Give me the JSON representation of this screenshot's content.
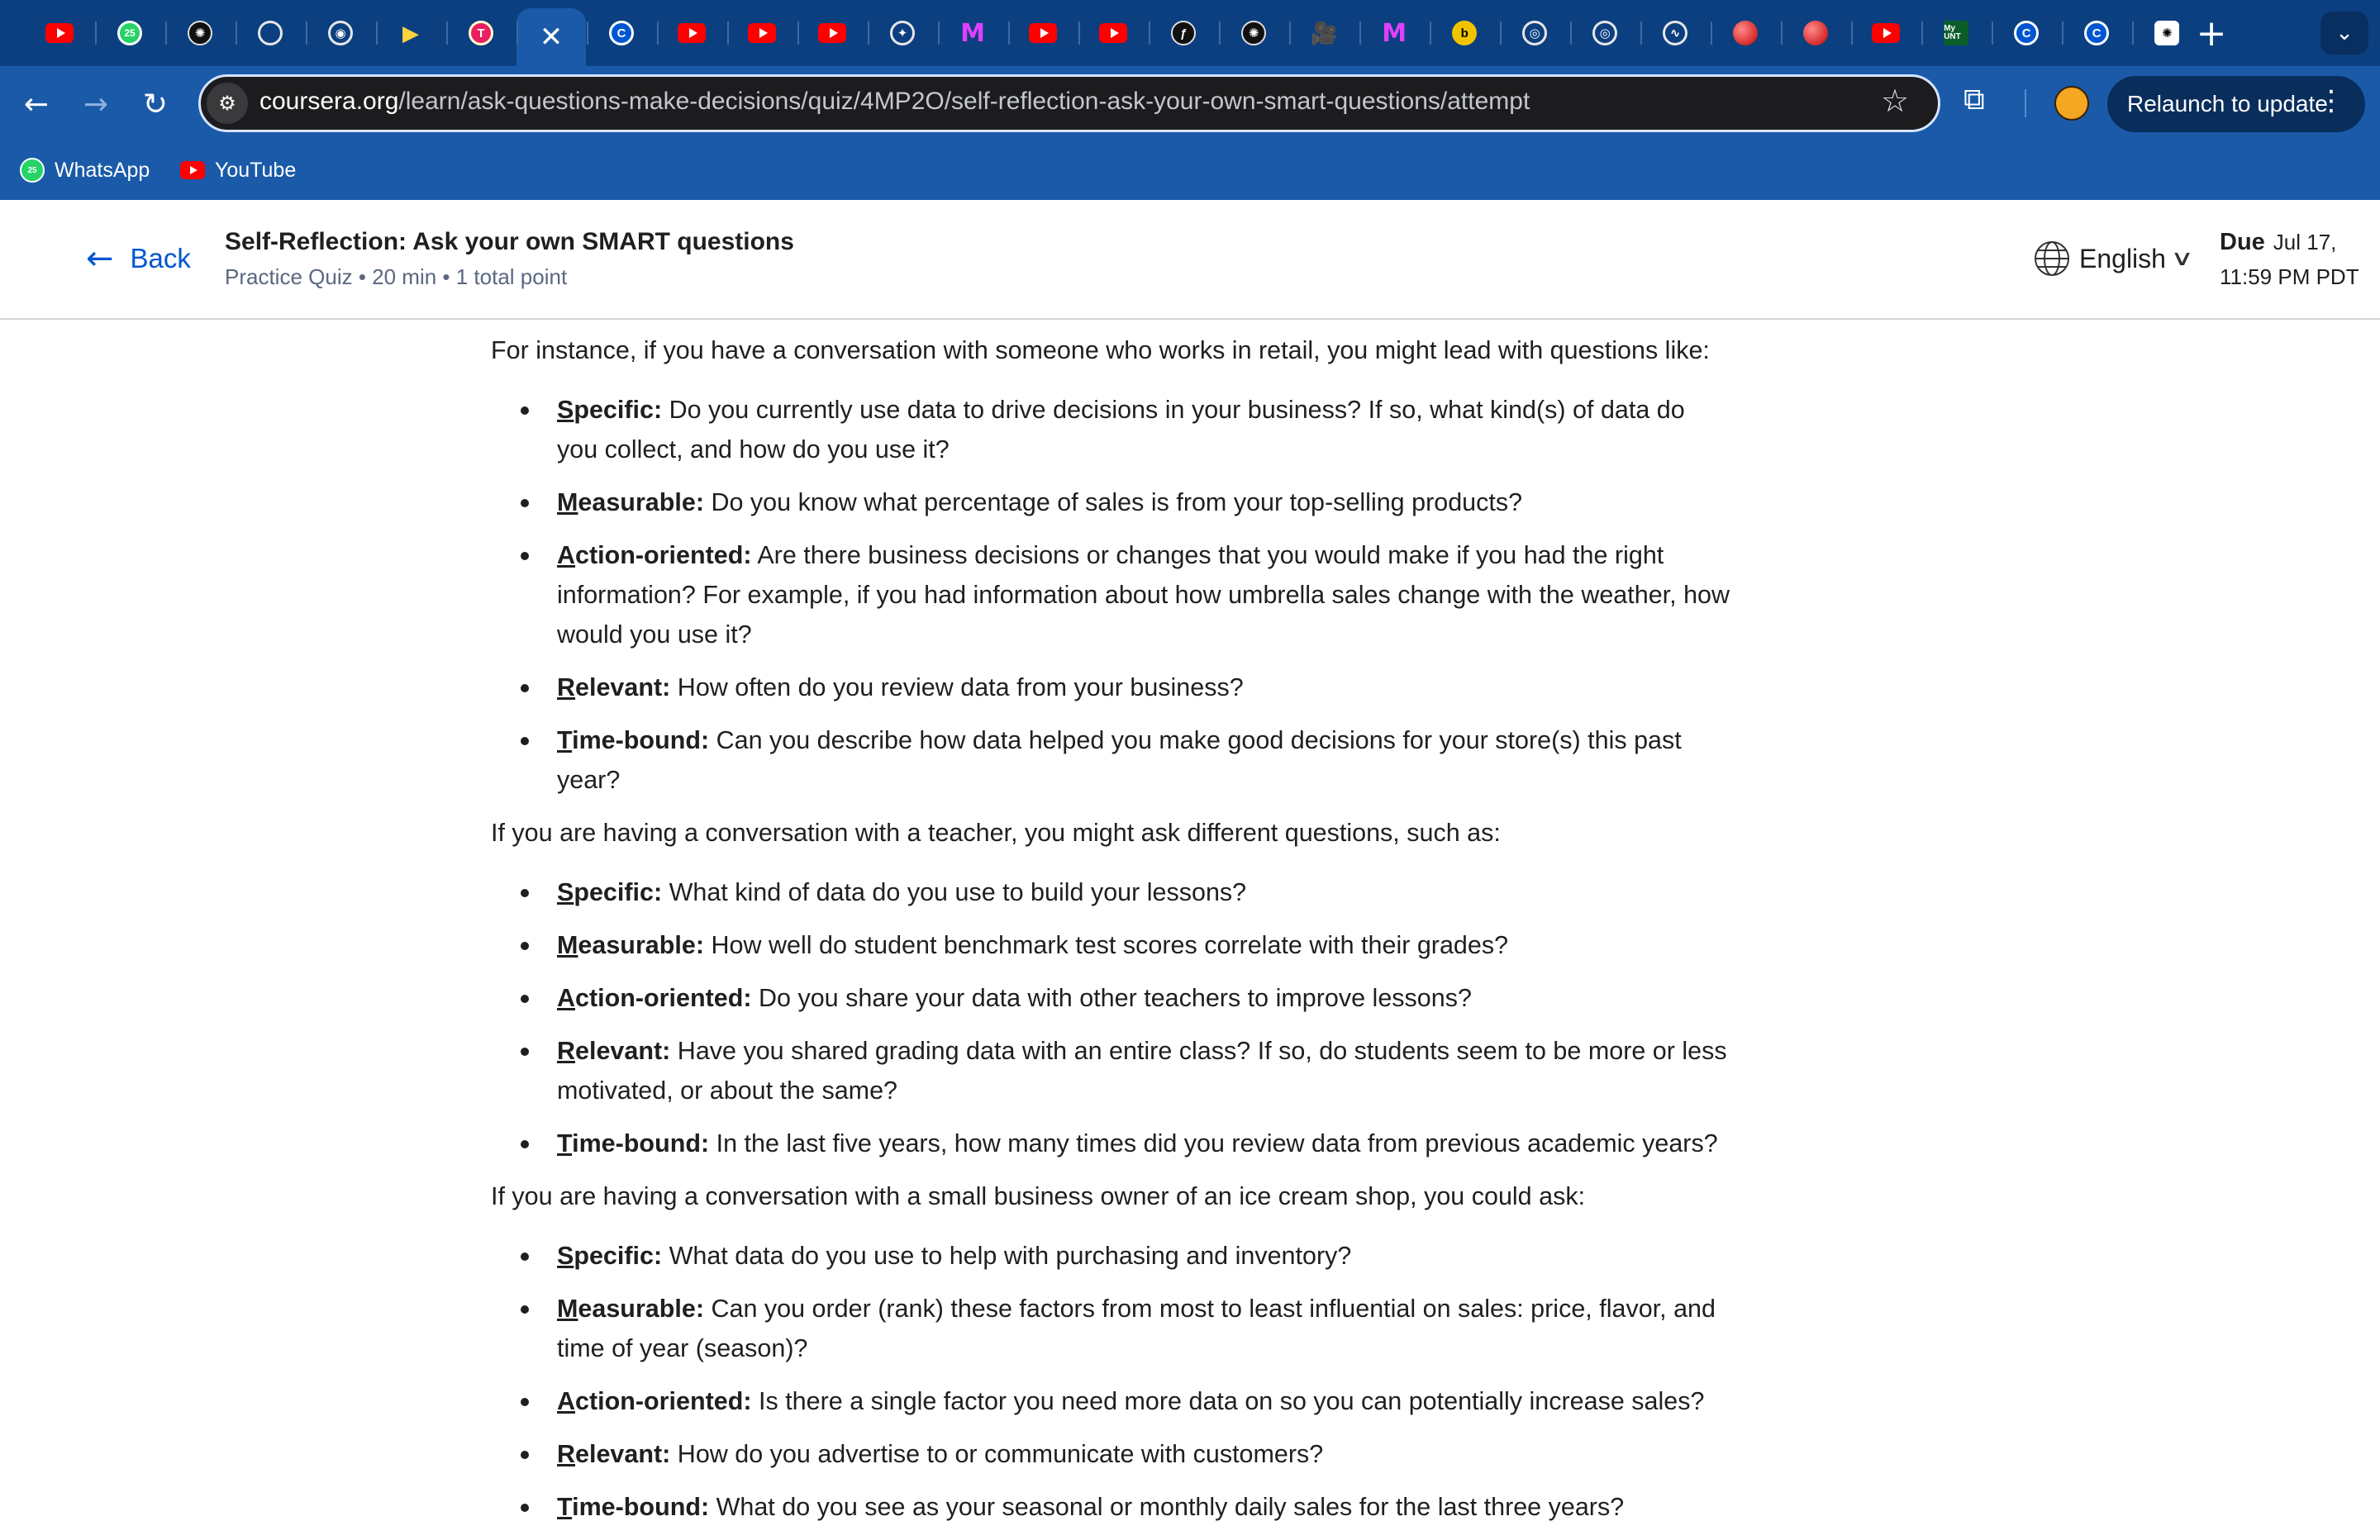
{
  "browser": {
    "tabs": [
      {
        "icon": "youtube-icon",
        "kind": "yt",
        "glyph": ""
      },
      {
        "icon": "whatsapp-icon",
        "kind": "wa",
        "glyph": "25"
      },
      {
        "icon": "openai-icon",
        "kind": "dark",
        "glyph": "✺"
      },
      {
        "icon": "loading-ring-icon",
        "kind": "ring",
        "glyph": ""
      },
      {
        "icon": "github-icon",
        "kind": "ring",
        "glyph": "◉"
      },
      {
        "icon": "google-play-icon",
        "kind": "play",
        "glyph": "▶"
      },
      {
        "icon": "tetr-icon",
        "kind": "pink",
        "glyph": "T"
      },
      {
        "icon": "close-tab-icon",
        "kind": "active",
        "glyph": "✕"
      },
      {
        "icon": "coursera-icon",
        "kind": "c",
        "glyph": "C"
      },
      {
        "icon": "youtube-icon",
        "kind": "yt",
        "glyph": ""
      },
      {
        "icon": "youtube-icon",
        "kind": "yt",
        "glyph": ""
      },
      {
        "icon": "youtube-icon",
        "kind": "yt",
        "glyph": ""
      },
      {
        "icon": "compass-icon",
        "kind": "ring",
        "glyph": "✦"
      },
      {
        "icon": "gmail-icon",
        "kind": "m",
        "glyph": "M"
      },
      {
        "icon": "youtube-icon",
        "kind": "yt",
        "glyph": ""
      },
      {
        "icon": "youtube-icon",
        "kind": "yt",
        "glyph": ""
      },
      {
        "icon": "signature-icon",
        "kind": "dark",
        "glyph": "ƒ"
      },
      {
        "icon": "openai-icon",
        "kind": "dark",
        "glyph": "✺"
      },
      {
        "icon": "video-camera-icon",
        "kind": "cam",
        "glyph": "🎥"
      },
      {
        "icon": "gmail-icon",
        "kind": "m",
        "glyph": "M"
      },
      {
        "icon": "b-logo-icon",
        "kind": "yel",
        "glyph": "b"
      },
      {
        "icon": "target-icon",
        "kind": "ring",
        "glyph": "◎"
      },
      {
        "icon": "target-icon",
        "kind": "ring",
        "glyph": "◎"
      },
      {
        "icon": "waveform-icon",
        "kind": "ring",
        "glyph": "∿"
      },
      {
        "icon": "red-ball-icon",
        "kind": "red3d",
        "glyph": ""
      },
      {
        "icon": "record-icon",
        "kind": "red3d",
        "glyph": ""
      },
      {
        "icon": "youtube-icon",
        "kind": "yt",
        "glyph": ""
      },
      {
        "icon": "my-unt-icon",
        "kind": "unt",
        "glyph": "My UNT"
      },
      {
        "icon": "coursera-icon",
        "kind": "c",
        "glyph": "C"
      },
      {
        "icon": "coursera-icon",
        "kind": "c",
        "glyph": "C"
      },
      {
        "icon": "chatgpt-icon",
        "kind": "white",
        "glyph": "✺"
      }
    ],
    "new_tab_glyph": "+",
    "tab_search_glyph": "⌄",
    "back_glyph": "←",
    "forward_glyph": "→",
    "reload_glyph": "↻",
    "site_info_glyph": "⚙",
    "url_host": "coursera.org",
    "url_path": "/learn/ask-questions-make-decisions/quiz/4MP2O/self-reflection-ask-your-own-smart-questions/attempt",
    "star_glyph": "☆",
    "extensions_glyph": "⧉",
    "relaunch_label": "Relaunch to update",
    "menu_glyph": "⋮",
    "bookmarks": [
      {
        "label": "WhatsApp",
        "icon": "whatsapp-icon",
        "kind": "wa",
        "badge": "25"
      },
      {
        "label": "YouTube",
        "icon": "youtube-icon",
        "kind": "yt",
        "badge": ""
      }
    ]
  },
  "header": {
    "back_label": "Back",
    "back_glyph": "←",
    "title": "Self-Reflection: Ask your own SMART questions",
    "meta": "Practice Quiz • 20 min • 1 total point",
    "language": "English",
    "chevron_glyph": "∨",
    "due_label": "Due",
    "due_date": "Jul 17,",
    "due_time": "11:59 PM PDT"
  },
  "content": {
    "sections": [
      {
        "intro": "For instance, if you have a conversation with someone who works in retail, you might lead with questions like:",
        "items": [
          {
            "first": "S",
            "rest": "pecific:",
            "text": " Do you currently use data to drive decisions in your business? If so, what kind(s) of data do you collect, and how do you use it?"
          },
          {
            "first": "M",
            "rest": "easurable:",
            "text": " Do you know what percentage of sales is from your top-selling products?"
          },
          {
            "first": "A",
            "rest": "ction-oriented:",
            "text": " Are there business decisions or changes that you would make if you had the right information? For example, if you had information about how umbrella sales change with the weather, how would you use it?"
          },
          {
            "first": "R",
            "rest": "elevant:",
            "text": " How often do you review data from your business?"
          },
          {
            "first": "T",
            "rest": "ime-bound:",
            "text": " Can you describe how data helped you make good decisions for your store(s) this past year?"
          }
        ]
      },
      {
        "intro": "If you are having a conversation with a teacher, you might ask different questions, such as:",
        "items": [
          {
            "first": "S",
            "rest": "pecific:",
            "text": " What kind of data do you use to build your lessons?"
          },
          {
            "first": "M",
            "rest": "easurable:",
            "text": " How well do student benchmark test scores correlate with their grades?"
          },
          {
            "first": "A",
            "rest": "ction-oriented:",
            "text": " Do you share your data with other teachers to improve lessons?"
          },
          {
            "first": "R",
            "rest": "elevant:",
            "text": " Have you shared grading data with an entire class? If so, do students seem to be more or less motivated, or about the same?"
          },
          {
            "first": "T",
            "rest": "ime-bound:",
            "text": " In the last five years, how many times did you review data from previous academic years?"
          }
        ]
      },
      {
        "intro": "If you are having a conversation with a small business owner of an ice cream shop, you could ask:",
        "items": [
          {
            "first": "S",
            "rest": "pecific:",
            "text": " What data do you use to help with purchasing and inventory?"
          },
          {
            "first": "M",
            "rest": "easurable:",
            "text": " Can you order (rank) these factors from most to least influential on sales: price, flavor, and time of year (season)?"
          },
          {
            "first": "A",
            "rest": "ction-oriented:",
            "text": " Is there a single factor you need more data on so you can potentially increase sales?"
          },
          {
            "first": "R",
            "rest": "elevant:",
            "text": " How do you advertise to or communicate with customers?"
          },
          {
            "first": "T",
            "rest": "ime-bound:",
            "text": " What do you see as your seasonal or monthly daily sales for the last three years?"
          }
        ]
      }
    ]
  },
  "colors": {
    "tabstrip": "#0b3f80",
    "toolbar": "#1a5aa8",
    "coursera_blue": "#0056d2",
    "text": "#1f1f1f"
  }
}
